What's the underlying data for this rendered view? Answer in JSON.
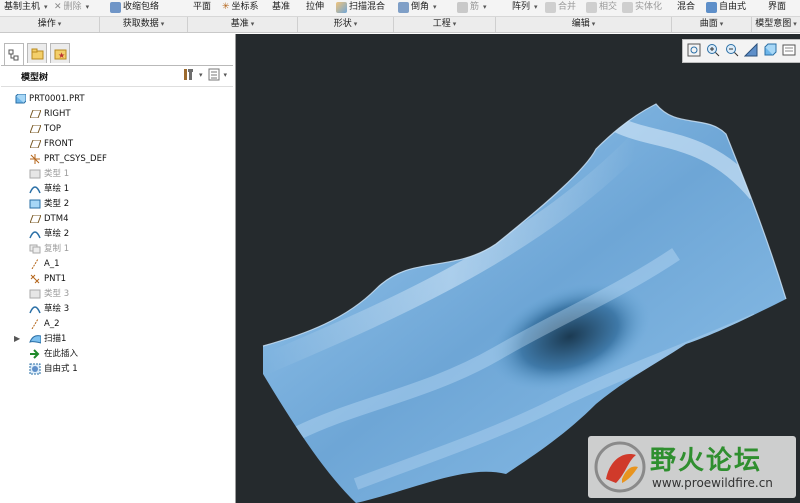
{
  "ribbon": {
    "tools": [
      {
        "label": "基制主机",
        "icon": "copy-icon",
        "enabled": true
      },
      {
        "label": "删除",
        "icon": "delete-icon",
        "enabled": false
      },
      {
        "label": "收缩包络",
        "icon": "shrinkwrap-icon",
        "enabled": true
      },
      {
        "label": "平面",
        "icon": "plane-icon",
        "enabled": true
      },
      {
        "label": "坐标系",
        "icon": "csys-icon",
        "enabled": true
      },
      {
        "label": "基准",
        "icon": "datum-icon",
        "enabled": true
      },
      {
        "label": "拉伸",
        "icon": "extrude-icon",
        "enabled": true
      },
      {
        "label": "扫描混合",
        "icon": "swept-blend-icon",
        "enabled": true
      },
      {
        "label": "倒角",
        "icon": "chamfer-icon",
        "enabled": true
      },
      {
        "label": "筋",
        "icon": "rib-icon",
        "enabled": false
      },
      {
        "label": "阵列",
        "icon": "pattern-icon",
        "enabled": true
      },
      {
        "label": "合并",
        "icon": "merge-icon",
        "enabled": false
      },
      {
        "label": "相交",
        "icon": "intersect-icon",
        "enabled": false
      },
      {
        "label": "实体化",
        "icon": "solidify-icon",
        "enabled": false
      },
      {
        "label": "混合",
        "icon": "blend-icon",
        "enabled": true
      },
      {
        "label": "自由式",
        "icon": "freestyle-icon",
        "enabled": true
      },
      {
        "label": "界面",
        "icon": "interface-icon",
        "enabled": true
      }
    ],
    "groups": [
      "操作",
      "获取数据",
      "基准",
      "形状",
      "工程",
      "编辑",
      "曲面",
      "模型意图"
    ]
  },
  "panel": {
    "title": "模型树",
    "tabs": [
      "model-tree-tab-icon",
      "folder-browser-tab-icon",
      "favorites-tab-icon"
    ]
  },
  "tree": [
    {
      "label": "PRT0001.PRT",
      "icon": "part-icon",
      "suppressed": false
    },
    {
      "label": "RIGHT",
      "icon": "datum-plane-icon",
      "suppressed": false
    },
    {
      "label": "TOP",
      "icon": "datum-plane-icon",
      "suppressed": false
    },
    {
      "label": "FRONT",
      "icon": "datum-plane-icon",
      "suppressed": false
    },
    {
      "label": "PRT_CSYS_DEF",
      "icon": "csys-icon",
      "suppressed": false
    },
    {
      "label": "类型 1",
      "icon": "feature-icon",
      "suppressed": true
    },
    {
      "label": "草绘 1",
      "icon": "sketch-icon",
      "suppressed": false
    },
    {
      "label": "类型 2",
      "icon": "feature-icon",
      "suppressed": false
    },
    {
      "label": "DTM4",
      "icon": "datum-plane-icon",
      "suppressed": false
    },
    {
      "label": "草绘 2",
      "icon": "sketch-icon",
      "suppressed": false
    },
    {
      "label": "复制 1",
      "icon": "copy-icon",
      "suppressed": true
    },
    {
      "label": "A_1",
      "icon": "axis-icon",
      "suppressed": false
    },
    {
      "label": "PNT1",
      "icon": "point-icon",
      "suppressed": false
    },
    {
      "label": "类型 3",
      "icon": "feature-icon",
      "suppressed": true
    },
    {
      "label": "草绘 3",
      "icon": "sketch-icon",
      "suppressed": false
    },
    {
      "label": "A_2",
      "icon": "axis-icon",
      "suppressed": false
    },
    {
      "label": "扫描1",
      "icon": "sweep-icon",
      "suppressed": false
    },
    {
      "label": "在此插入",
      "icon": "insert-here-icon",
      "suppressed": false
    },
    {
      "label": "自由式 1",
      "icon": "freestyle-icon",
      "suppressed": false
    }
  ],
  "view_toolbar": [
    "refit-icon",
    "zoom-in-icon",
    "zoom-out-icon",
    "repaint-icon",
    "display-style-icon",
    "saved-views-icon"
  ],
  "watermark": {
    "title": "野火论坛",
    "url": "www.proewildfire.cn"
  },
  "colors": {
    "viewport_bg": "#252a2d",
    "surface_light": "#a9d4f5",
    "surface_dark": "#1b3a52",
    "brand_green": "#2f8f2f"
  }
}
